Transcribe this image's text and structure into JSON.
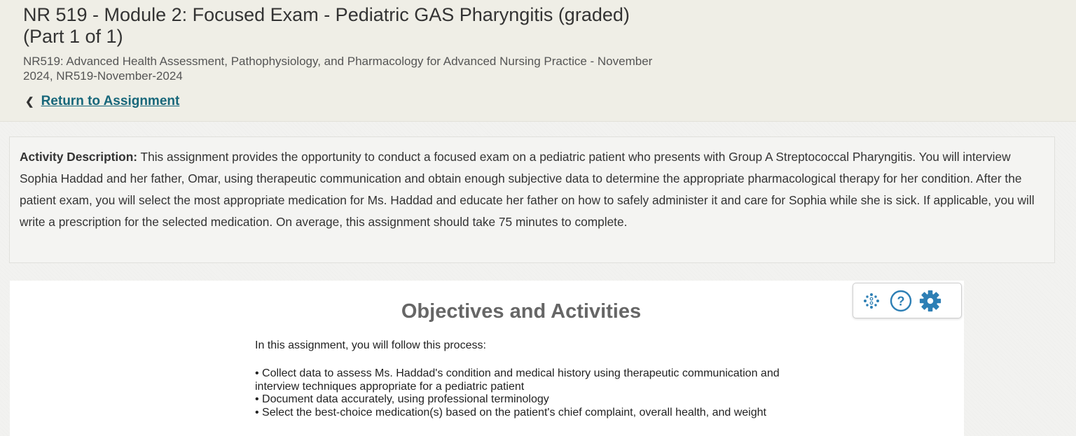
{
  "header": {
    "title": "NR 519 - Module 2: Focused Exam - Pediatric GAS Pharyngitis (graded) (Part 1 of 1)",
    "course": "NR519: Advanced Health Assessment, Pathophysiology, and Pharmacology for Advanced Nursing Practice - November 2024, NR519-November-2024",
    "return_link": "Return to Assignment"
  },
  "activity": {
    "label": "Activity Description:",
    "text": "This assignment provides the opportunity to conduct a focused exam on a pediatric patient who presents with Group A Streptococcal Pharyngitis. You will interview Sophia Haddad and her father, Omar, using therapeutic communication and obtain enough subjective data to determine the appropriate pharmacological therapy for her condition. After the patient exam, you will select the most appropriate medication for Ms. Haddad and educate her father on how to safely administer it and care for Sophia while she is sick. If applicable, you will write a prescription for the selected medication. On average, this assignment should take 75 minutes to complete."
  },
  "frame": {
    "title": "Objectives and Activities",
    "intro": "In this assignment, you will follow this process:",
    "bullets": [
      "• Collect data to assess Ms. Haddad's condition and medical history using therapeutic communication and interview techniques appropriate for a pediatric patient",
      "• Document data accurately, using professional terminology",
      "• Select the best-choice medication(s) based on the patient's chief complaint, overall health, and weight"
    ],
    "tools": [
      "accessibility-icon",
      "help-icon",
      "settings-gear-icon"
    ]
  },
  "colors": {
    "link": "#17677a",
    "tool_icon": "#2d7fb5",
    "header_bg": "#efeee6"
  }
}
